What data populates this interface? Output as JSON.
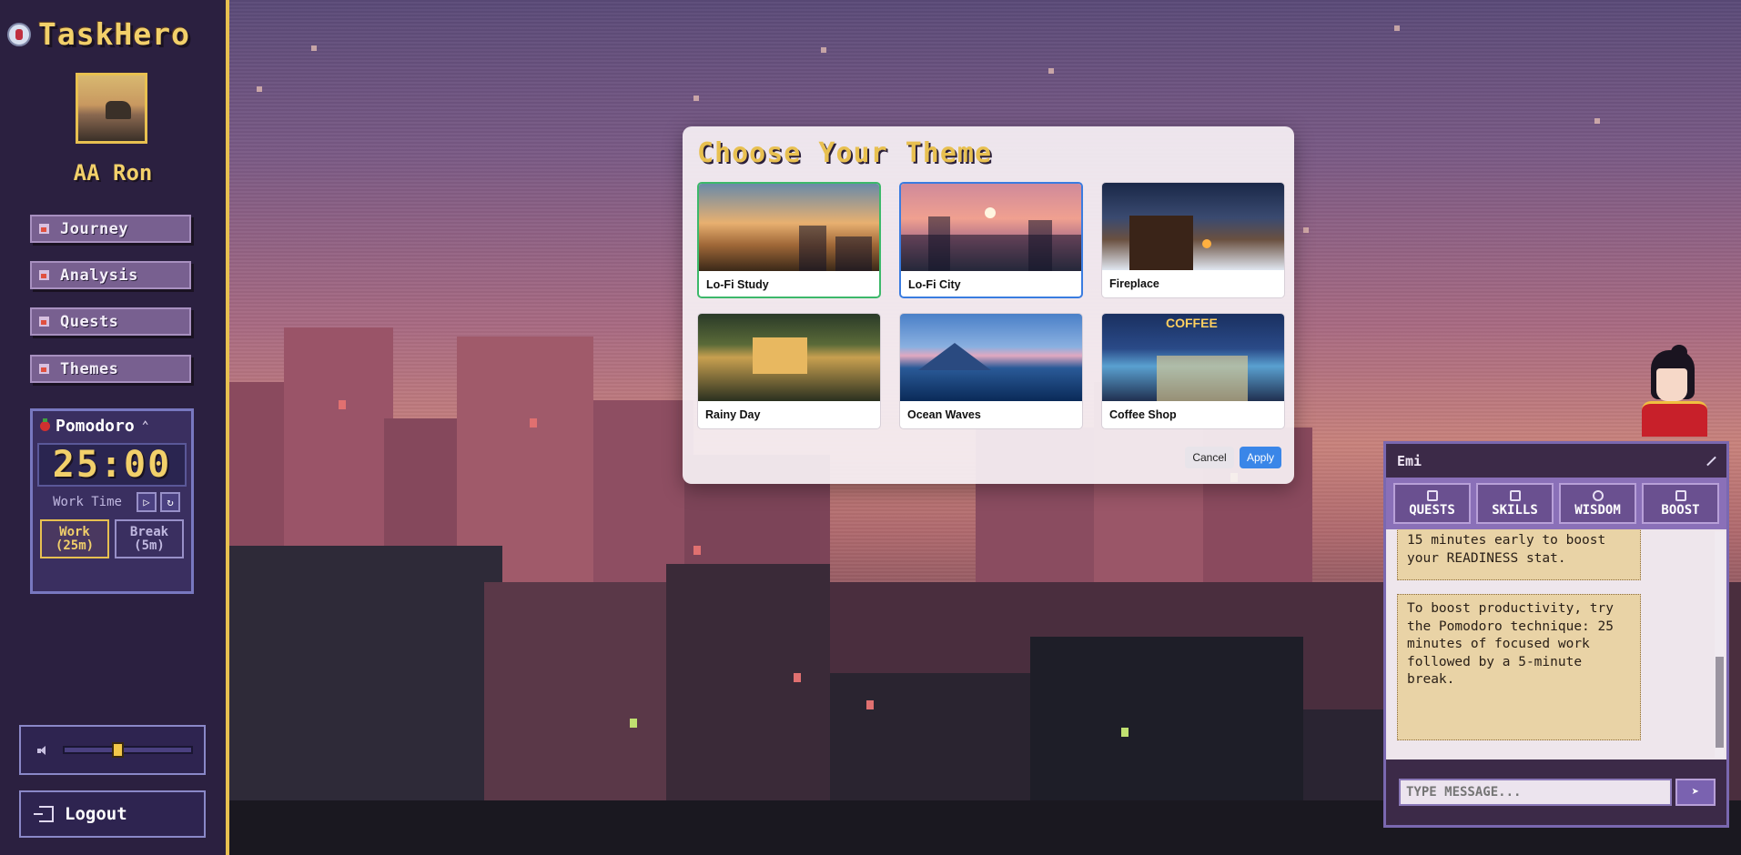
{
  "app": {
    "title": "TaskHero"
  },
  "user": {
    "name": "AA Ron"
  },
  "nav": [
    {
      "label": "Journey",
      "icon": "home-icon"
    },
    {
      "label": "Analysis",
      "icon": "chart-icon"
    },
    {
      "label": "Quests",
      "icon": "scroll-icon"
    },
    {
      "label": "Themes",
      "icon": "palette-icon"
    }
  ],
  "pomodoro": {
    "title": "Pomodoro",
    "time": "25:00",
    "phase_label": "Work Time",
    "modes": [
      {
        "label": "Work (25m)",
        "active": true
      },
      {
        "label": "Break (5m)",
        "active": false
      }
    ]
  },
  "volume": {
    "level": 0.41
  },
  "logout": {
    "label": "Logout"
  },
  "theme_modal": {
    "title": "Choose Your Theme",
    "themes": [
      {
        "name": "Lo-Fi Study",
        "state": "current"
      },
      {
        "name": "Lo-Fi City",
        "state": "selected"
      },
      {
        "name": "Fireplace",
        "state": ""
      },
      {
        "name": "Rainy Day",
        "state": ""
      },
      {
        "name": "Ocean Waves",
        "state": ""
      },
      {
        "name": "Coffee Shop",
        "state": ""
      }
    ],
    "coffee_sign": "COFFEE",
    "cancel_label": "Cancel",
    "apply_label": "Apply"
  },
  "chat": {
    "assistant_name": "Emi",
    "tabs": [
      "QUESTS",
      "SKILLS",
      "WISDOM",
      "BOOST"
    ],
    "messages": [
      "15 minutes early to boost your READINESS stat.",
      "To boost productivity, try the Pomodoro technique: 25 minutes of focused work followed by a 5-minute break."
    ],
    "input_placeholder": "TYPE MESSAGE..."
  },
  "colors": {
    "accent": "#e8c050",
    "sidebar": "#2b2040",
    "apply": "#3a86e8",
    "selected_green": "#3cb86a",
    "selected_blue": "#3a7ce0"
  }
}
